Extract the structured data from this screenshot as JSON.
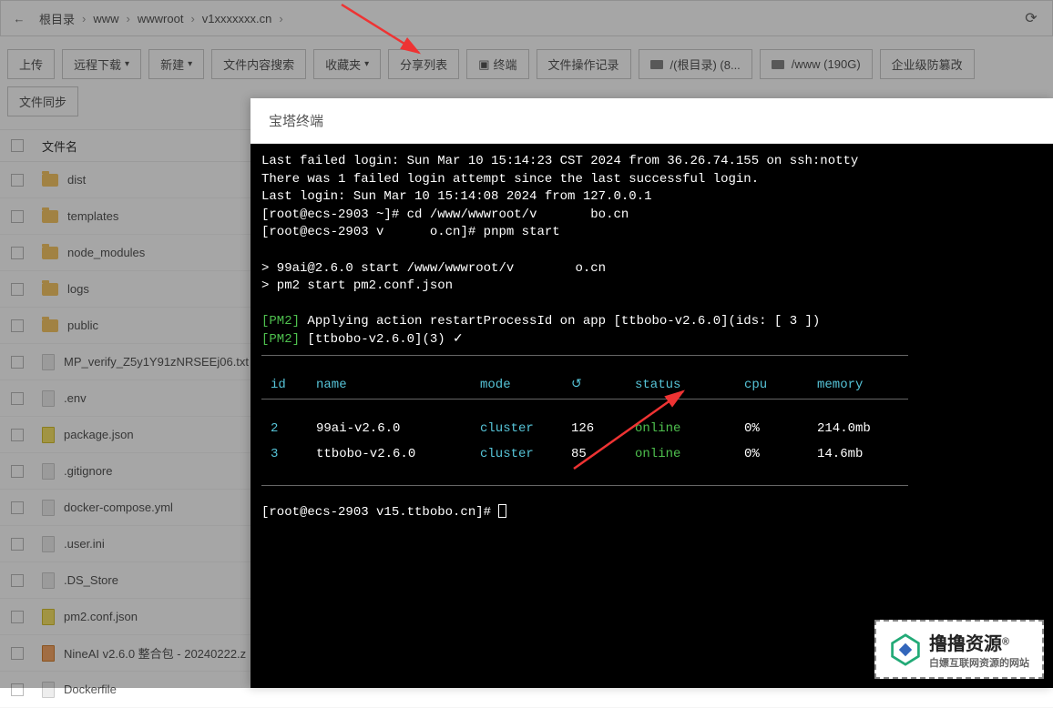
{
  "breadcrumb": {
    "root": "根目录",
    "p1": "www",
    "p2": "wwwroot",
    "p3_prefix": "v1",
    "p3_suffix": ".cn"
  },
  "toolbar": {
    "upload": "上传",
    "remote_download": "远程下载",
    "new": "新建",
    "content_search": "文件内容搜索",
    "favorites": "收藏夹",
    "share_list": "分享列表",
    "terminal": "终端",
    "file_history": "文件操作记录",
    "disk_root": "/(根目录) (8...",
    "disk_www": "/www (190G)",
    "tamper_proof": "企业级防篡改",
    "file_sync": "文件同步"
  },
  "file_header": {
    "name": "文件名"
  },
  "files": [
    {
      "name": "dist",
      "type": "folder"
    },
    {
      "name": "templates",
      "type": "folder"
    },
    {
      "name": "node_modules",
      "type": "folder"
    },
    {
      "name": "logs",
      "type": "folder"
    },
    {
      "name": "public",
      "type": "folder"
    },
    {
      "name": "MP_verify_Z5y1Y91zNRSEEj06.txt",
      "type": "file"
    },
    {
      "name": ".env",
      "type": "file"
    },
    {
      "name": "package.json",
      "type": "js"
    },
    {
      "name": ".gitignore",
      "type": "file"
    },
    {
      "name": "docker-compose.yml",
      "type": "file"
    },
    {
      "name": ".user.ini",
      "type": "file"
    },
    {
      "name": ".DS_Store",
      "type": "file"
    },
    {
      "name": "pm2.conf.json",
      "type": "js"
    },
    {
      "name": "NineAI v2.6.0 整合包 - 20240222.z",
      "type": "zip"
    },
    {
      "name": "Dockerfile",
      "type": "file"
    }
  ],
  "terminal": {
    "title": "宝塔终端",
    "login_fail": "Last failed login: Sun Mar 10 15:14:23 CST 2024 from 36.26.74.155 on ssh:notty",
    "login_attempt": "There was 1 failed login attempt since the last successful login.",
    "last_login": "Last login: Sun Mar 10 15:14:08 2024 from 127.0.0.1",
    "prompt1_a": "[root@ecs-2903 ~]#",
    "prompt1_cmd_a": "cd /www/wwwroot/v",
    "prompt1_cmd_b": "bo.cn",
    "prompt2_a": "[root@ecs-2903 v",
    "prompt2_b": "o.cn]#",
    "prompt2_cmd": "pnpm start",
    "start_line_a": "> 99ai@2.6.0 start /www/wwwroot/v",
    "start_line_b": "o.cn",
    "pm2_line": "> pm2 start pm2.conf.json",
    "pm2_apply": " Applying action restartProcessId on app [ttbobo-v2.6.0](ids: [ 3 ])",
    "pm2_restart": " [ttbobo-v2.6.0](3) ✓",
    "pm2_tag": "[PM2]",
    "headers": {
      "id": "id",
      "name": "name",
      "mode": "mode",
      "restart": "↺",
      "status": "status",
      "cpu": "cpu",
      "memory": "memory"
    },
    "rows": [
      {
        "id": "2",
        "name": "99ai-v2.6.0",
        "mode": "cluster",
        "restart": "126",
        "status": "online",
        "cpu": "0%",
        "memory": "214.0mb"
      },
      {
        "id": "3",
        "name": "ttbobo-v2.6.0",
        "mode": "cluster",
        "restart": "85",
        "status": "online",
        "cpu": "0%",
        "memory": "14.6mb"
      }
    ],
    "final_prompt": "[root@ecs-2903 v15.ttbobo.cn]#"
  },
  "watermark": {
    "main": "撸撸资源",
    "reg": "®",
    "sub": "白嫖互联网资源的网站"
  }
}
